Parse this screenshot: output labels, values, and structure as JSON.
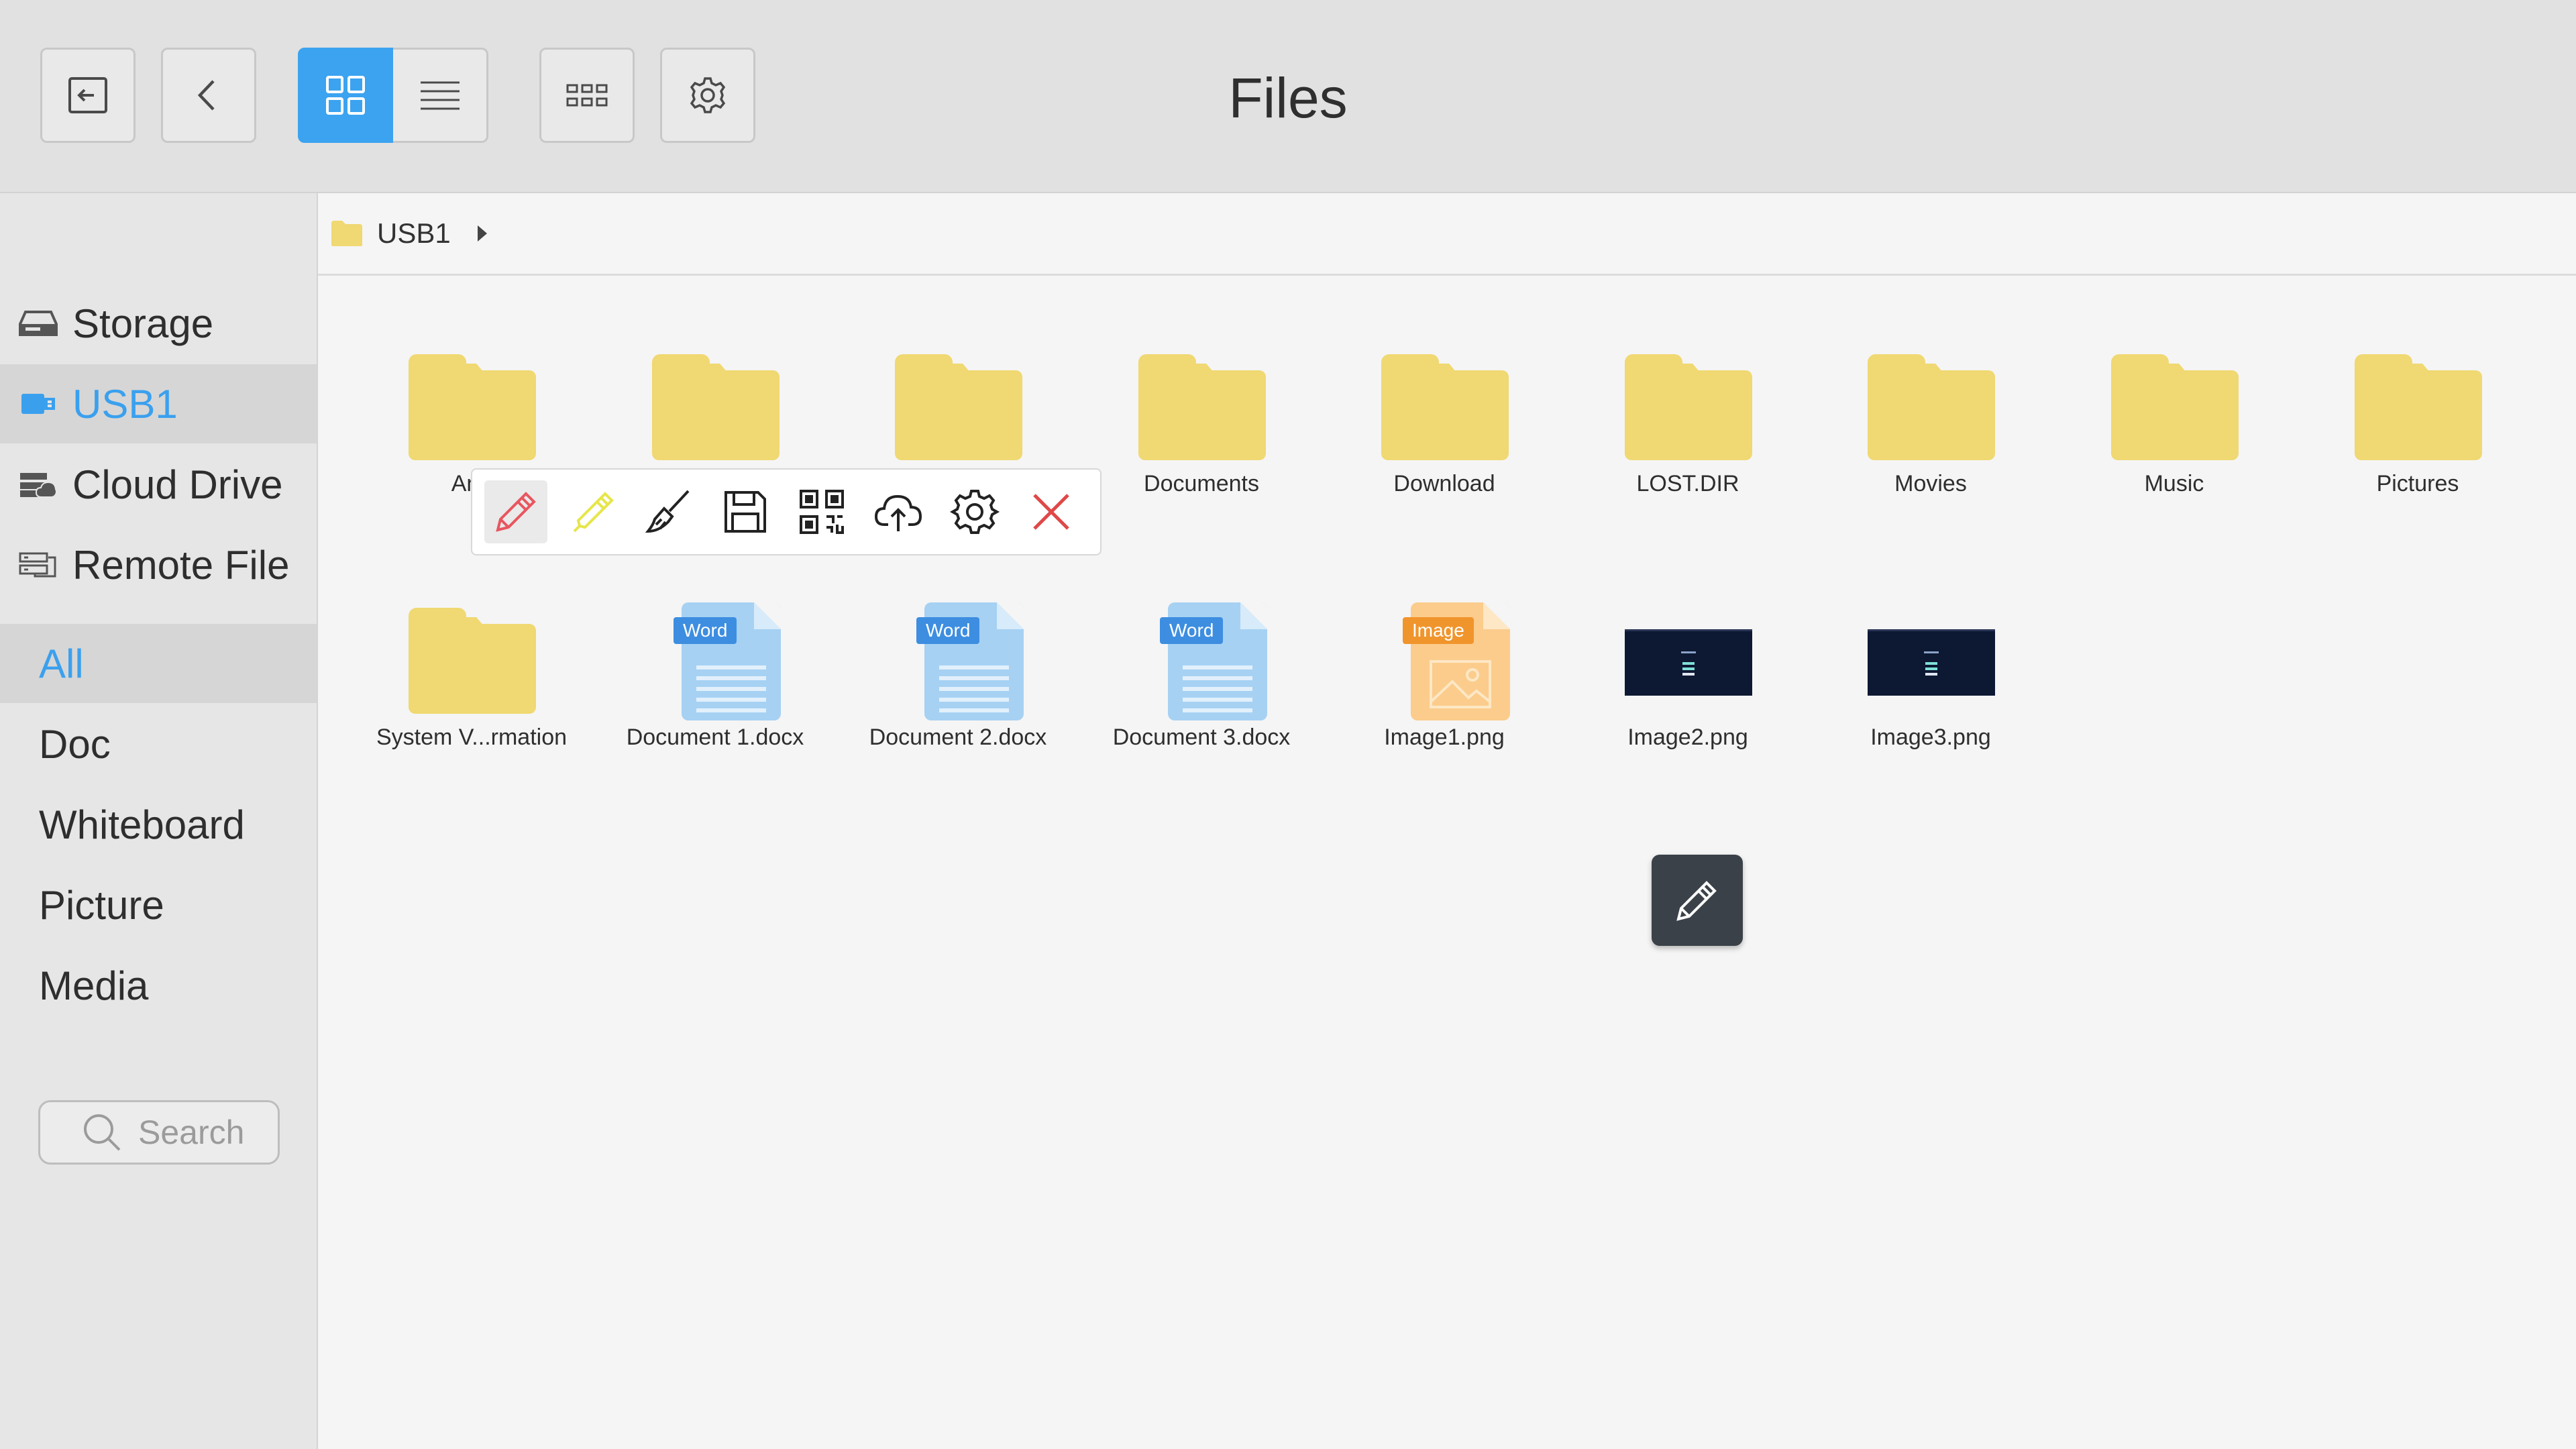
{
  "header": {
    "title": "Files"
  },
  "toolbar": {
    "exit_icon": "exit-icon",
    "back_icon": "back-icon",
    "grid_view_icon": "grid-view-icon",
    "list_view_icon": "list-view-icon",
    "thumbnail_icon": "thumbnail-icon",
    "settings_icon": "gear-icon"
  },
  "sidebar": {
    "sources": [
      {
        "label": "Storage",
        "icon": "storage-icon"
      },
      {
        "label": "USB1",
        "icon": "usb-icon",
        "selected": true
      },
      {
        "label": "Cloud Drive",
        "icon": "cloud-drive-icon"
      },
      {
        "label": "Remote File",
        "icon": "remote-file-icon"
      }
    ],
    "categories": [
      {
        "label": "All",
        "selected": true
      },
      {
        "label": "Doc"
      },
      {
        "label": "Whiteboard"
      },
      {
        "label": "Picture"
      },
      {
        "label": "Media"
      }
    ],
    "search": {
      "placeholder": "Search"
    }
  },
  "breadcrumb": {
    "path": "USB1"
  },
  "files": [
    {
      "name": "And",
      "type": "folder"
    },
    {
      "name": "",
      "type": "folder"
    },
    {
      "name": "",
      "type": "folder"
    },
    {
      "name": "Documents",
      "type": "folder"
    },
    {
      "name": "Download",
      "type": "folder"
    },
    {
      "name": "LOST.DIR",
      "type": "folder"
    },
    {
      "name": "Movies",
      "type": "folder"
    },
    {
      "name": "Music",
      "type": "folder"
    },
    {
      "name": "Pictures",
      "type": "folder"
    },
    {
      "name": "System V...rmation",
      "type": "folder"
    },
    {
      "name": "Document 1.docx",
      "type": "word",
      "tag": "Word"
    },
    {
      "name": "Document 2.docx",
      "type": "word",
      "tag": "Word"
    },
    {
      "name": "Document 3.docx",
      "type": "word",
      "tag": "Word"
    },
    {
      "name": "Image1.png",
      "type": "image",
      "tag": "Image"
    },
    {
      "name": "Image2.png",
      "type": "thumbnail"
    },
    {
      "name": "Image3.png",
      "type": "thumbnail"
    }
  ],
  "annotation_toolbar": {
    "tools": [
      "pen-icon",
      "highlighter-icon",
      "brush-icon",
      "save-icon",
      "qr-code-icon",
      "cloud-upload-icon",
      "gear-icon",
      "close-icon"
    ],
    "selected": "pen-icon",
    "colors": {
      "pen": "#e8565f",
      "highlighter": "#e6e64a",
      "close": "#e04848"
    }
  },
  "floating_button": {
    "icon": "pencil-icon"
  },
  "colors": {
    "accent": "#3ba3f0",
    "folder": "#f0d872",
    "word_tag": "#3d8ee0",
    "image_tag": "#f0952c"
  }
}
